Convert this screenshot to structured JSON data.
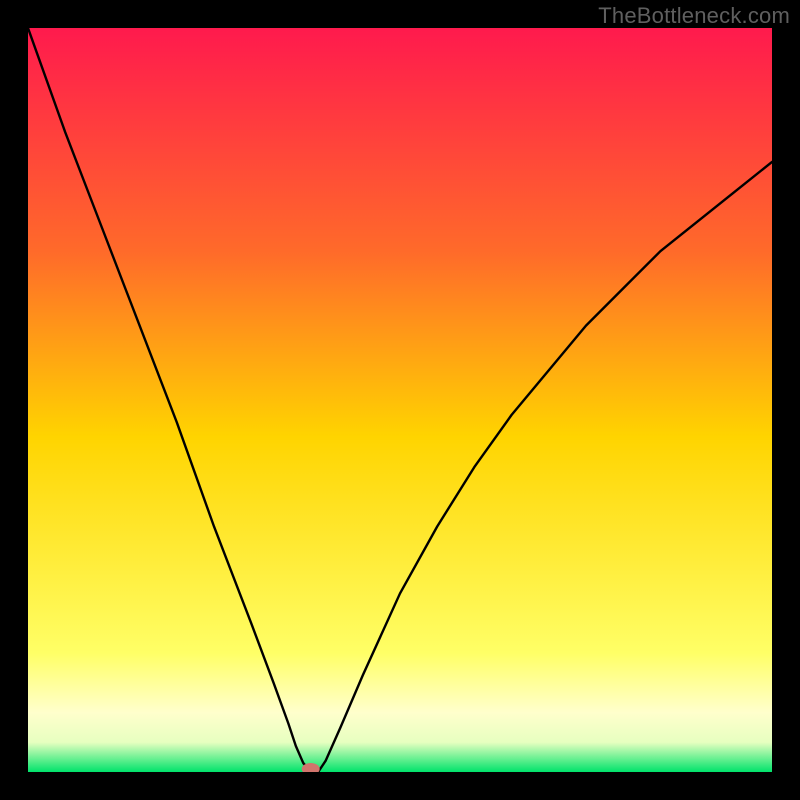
{
  "watermark": "TheBottleneck.com",
  "chart_data": {
    "type": "line",
    "title": "",
    "xlabel": "",
    "ylabel": "",
    "xlim": [
      0,
      100
    ],
    "ylim": [
      0,
      100
    ],
    "grid": false,
    "legend": false,
    "marker": {
      "x": 38,
      "y": 0,
      "color": "#d1746c"
    },
    "series": [
      {
        "name": "bottleneck-curve",
        "color": "#000000",
        "x": [
          0,
          5,
          10,
          15,
          20,
          25,
          30,
          33,
          35,
          36,
          37,
          38,
          39,
          40,
          42,
          45,
          50,
          55,
          60,
          65,
          70,
          75,
          80,
          85,
          90,
          95,
          100
        ],
        "y": [
          100,
          86,
          73,
          60,
          47,
          33,
          20,
          12,
          6.5,
          3.5,
          1.2,
          0,
          0,
          1.5,
          6,
          13,
          24,
          33,
          41,
          48,
          54,
          60,
          65,
          70,
          74,
          78,
          82
        ]
      }
    ],
    "background_gradient": {
      "top": "#ff1a4d",
      "middle": "#ffd400",
      "bottom": "#00e36b"
    }
  }
}
